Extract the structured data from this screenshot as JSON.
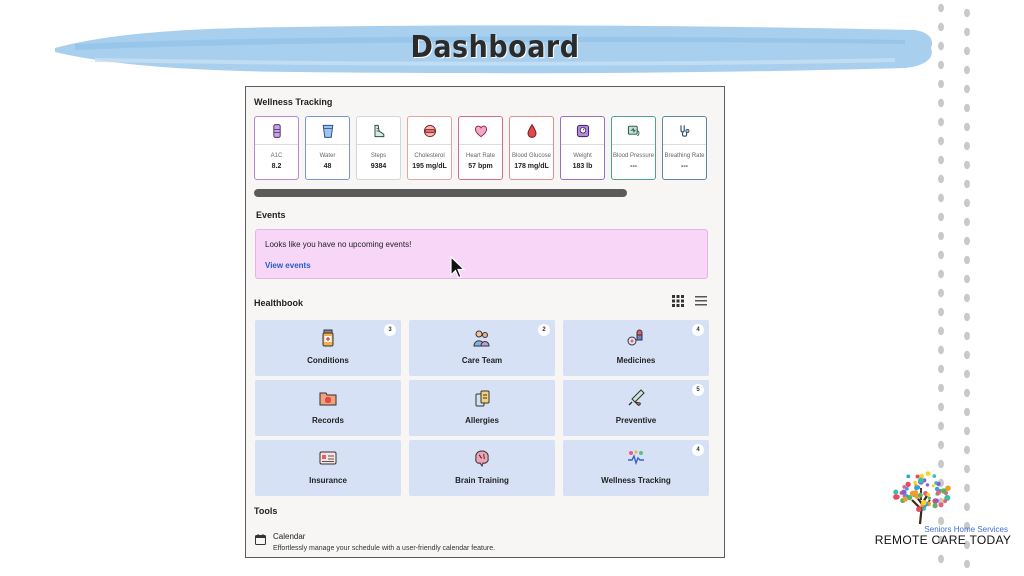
{
  "banner": {
    "title": "Dashboard"
  },
  "wellness": {
    "title": "Wellness Tracking",
    "metrics": [
      {
        "label": "A1C",
        "value": "8.2",
        "icon": "test-tube-icon",
        "color": "#b58ad0"
      },
      {
        "label": "Water",
        "value": "48",
        "icon": "water-glass-icon",
        "color": "#7b96d6"
      },
      {
        "label": "Steps",
        "value": "9384",
        "icon": "shoe-icon",
        "color": "#cfd8d6"
      },
      {
        "label": "Cholesterol",
        "value": "195 mg/dL",
        "icon": "cholesterol-icon",
        "color": "#e3a4a4"
      },
      {
        "label": "Heart Rate",
        "value": "57 bpm",
        "icon": "heart-icon",
        "color": "#d86b8b"
      },
      {
        "label": "Blood Glucose",
        "value": "178 mg/dL",
        "icon": "blood-drop-icon",
        "color": "#e28f8f"
      },
      {
        "label": "Weight",
        "value": "183 lb",
        "icon": "scale-icon",
        "color": "#9470c8"
      },
      {
        "label": "Blood Pressure",
        "value": "---",
        "icon": "blood-pressure-icon",
        "color": "#4ea18a"
      },
      {
        "label": "Breathing Rate",
        "value": "---",
        "icon": "stethoscope-icon",
        "color": "#5b87a8"
      }
    ]
  },
  "events": {
    "title": "Events",
    "message": "Looks like you have no upcoming events!",
    "link": "View events"
  },
  "healthbook": {
    "title": "Healthbook",
    "tiles": [
      {
        "label": "Conditions",
        "badge": "3",
        "icon": "pill-bottle-icon"
      },
      {
        "label": "Care Team",
        "badge": "2",
        "icon": "care-team-icon"
      },
      {
        "label": "Medicines",
        "badge": "4",
        "icon": "medicines-icon"
      },
      {
        "label": "Records",
        "badge": "",
        "icon": "records-icon"
      },
      {
        "label": "Allergies",
        "badge": "",
        "icon": "allergies-icon"
      },
      {
        "label": "Preventive",
        "badge": "5",
        "icon": "syringe-icon"
      },
      {
        "label": "Insurance",
        "badge": "",
        "icon": "insurance-card-icon"
      },
      {
        "label": "Brain Training",
        "badge": "",
        "icon": "brain-icon"
      },
      {
        "label": "Wellness Tracking",
        "badge": "4",
        "icon": "wellness-icon"
      }
    ]
  },
  "tools": {
    "title": "Tools",
    "items": [
      {
        "name": "Calendar",
        "description": "Effortlessly manage your schedule with a user-friendly calendar feature.",
        "icon": "calendar-icon"
      }
    ]
  },
  "logo": {
    "subtitle": "Seniors Home Services",
    "name": "REMOTE CARE TODAY"
  }
}
